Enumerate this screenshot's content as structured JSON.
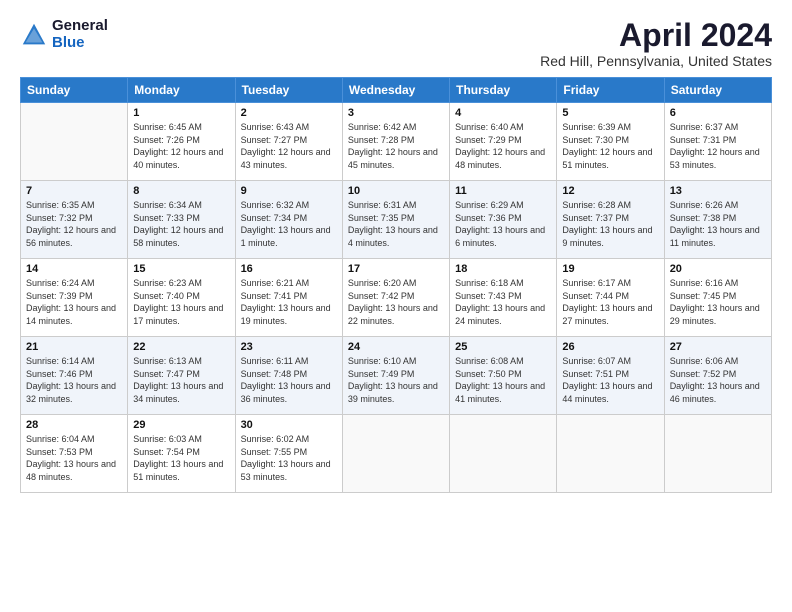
{
  "logo": {
    "general": "General",
    "blue": "Blue"
  },
  "title": "April 2024",
  "location": "Red Hill, Pennsylvania, United States",
  "days": [
    "Sunday",
    "Monday",
    "Tuesday",
    "Wednesday",
    "Thursday",
    "Friday",
    "Saturday"
  ],
  "weeks": [
    [
      {
        "date": "",
        "sunrise": "",
        "sunset": "",
        "daylight": ""
      },
      {
        "date": "1",
        "sunrise": "Sunrise: 6:45 AM",
        "sunset": "Sunset: 7:26 PM",
        "daylight": "Daylight: 12 hours and 40 minutes."
      },
      {
        "date": "2",
        "sunrise": "Sunrise: 6:43 AM",
        "sunset": "Sunset: 7:27 PM",
        "daylight": "Daylight: 12 hours and 43 minutes."
      },
      {
        "date": "3",
        "sunrise": "Sunrise: 6:42 AM",
        "sunset": "Sunset: 7:28 PM",
        "daylight": "Daylight: 12 hours and 45 minutes."
      },
      {
        "date": "4",
        "sunrise": "Sunrise: 6:40 AM",
        "sunset": "Sunset: 7:29 PM",
        "daylight": "Daylight: 12 hours and 48 minutes."
      },
      {
        "date": "5",
        "sunrise": "Sunrise: 6:39 AM",
        "sunset": "Sunset: 7:30 PM",
        "daylight": "Daylight: 12 hours and 51 minutes."
      },
      {
        "date": "6",
        "sunrise": "Sunrise: 6:37 AM",
        "sunset": "Sunset: 7:31 PM",
        "daylight": "Daylight: 12 hours and 53 minutes."
      }
    ],
    [
      {
        "date": "7",
        "sunrise": "Sunrise: 6:35 AM",
        "sunset": "Sunset: 7:32 PM",
        "daylight": "Daylight: 12 hours and 56 minutes."
      },
      {
        "date": "8",
        "sunrise": "Sunrise: 6:34 AM",
        "sunset": "Sunset: 7:33 PM",
        "daylight": "Daylight: 12 hours and 58 minutes."
      },
      {
        "date": "9",
        "sunrise": "Sunrise: 6:32 AM",
        "sunset": "Sunset: 7:34 PM",
        "daylight": "Daylight: 13 hours and 1 minute."
      },
      {
        "date": "10",
        "sunrise": "Sunrise: 6:31 AM",
        "sunset": "Sunset: 7:35 PM",
        "daylight": "Daylight: 13 hours and 4 minutes."
      },
      {
        "date": "11",
        "sunrise": "Sunrise: 6:29 AM",
        "sunset": "Sunset: 7:36 PM",
        "daylight": "Daylight: 13 hours and 6 minutes."
      },
      {
        "date": "12",
        "sunrise": "Sunrise: 6:28 AM",
        "sunset": "Sunset: 7:37 PM",
        "daylight": "Daylight: 13 hours and 9 minutes."
      },
      {
        "date": "13",
        "sunrise": "Sunrise: 6:26 AM",
        "sunset": "Sunset: 7:38 PM",
        "daylight": "Daylight: 13 hours and 11 minutes."
      }
    ],
    [
      {
        "date": "14",
        "sunrise": "Sunrise: 6:24 AM",
        "sunset": "Sunset: 7:39 PM",
        "daylight": "Daylight: 13 hours and 14 minutes."
      },
      {
        "date": "15",
        "sunrise": "Sunrise: 6:23 AM",
        "sunset": "Sunset: 7:40 PM",
        "daylight": "Daylight: 13 hours and 17 minutes."
      },
      {
        "date": "16",
        "sunrise": "Sunrise: 6:21 AM",
        "sunset": "Sunset: 7:41 PM",
        "daylight": "Daylight: 13 hours and 19 minutes."
      },
      {
        "date": "17",
        "sunrise": "Sunrise: 6:20 AM",
        "sunset": "Sunset: 7:42 PM",
        "daylight": "Daylight: 13 hours and 22 minutes."
      },
      {
        "date": "18",
        "sunrise": "Sunrise: 6:18 AM",
        "sunset": "Sunset: 7:43 PM",
        "daylight": "Daylight: 13 hours and 24 minutes."
      },
      {
        "date": "19",
        "sunrise": "Sunrise: 6:17 AM",
        "sunset": "Sunset: 7:44 PM",
        "daylight": "Daylight: 13 hours and 27 minutes."
      },
      {
        "date": "20",
        "sunrise": "Sunrise: 6:16 AM",
        "sunset": "Sunset: 7:45 PM",
        "daylight": "Daylight: 13 hours and 29 minutes."
      }
    ],
    [
      {
        "date": "21",
        "sunrise": "Sunrise: 6:14 AM",
        "sunset": "Sunset: 7:46 PM",
        "daylight": "Daylight: 13 hours and 32 minutes."
      },
      {
        "date": "22",
        "sunrise": "Sunrise: 6:13 AM",
        "sunset": "Sunset: 7:47 PM",
        "daylight": "Daylight: 13 hours and 34 minutes."
      },
      {
        "date": "23",
        "sunrise": "Sunrise: 6:11 AM",
        "sunset": "Sunset: 7:48 PM",
        "daylight": "Daylight: 13 hours and 36 minutes."
      },
      {
        "date": "24",
        "sunrise": "Sunrise: 6:10 AM",
        "sunset": "Sunset: 7:49 PM",
        "daylight": "Daylight: 13 hours and 39 minutes."
      },
      {
        "date": "25",
        "sunrise": "Sunrise: 6:08 AM",
        "sunset": "Sunset: 7:50 PM",
        "daylight": "Daylight: 13 hours and 41 minutes."
      },
      {
        "date": "26",
        "sunrise": "Sunrise: 6:07 AM",
        "sunset": "Sunset: 7:51 PM",
        "daylight": "Daylight: 13 hours and 44 minutes."
      },
      {
        "date": "27",
        "sunrise": "Sunrise: 6:06 AM",
        "sunset": "Sunset: 7:52 PM",
        "daylight": "Daylight: 13 hours and 46 minutes."
      }
    ],
    [
      {
        "date": "28",
        "sunrise": "Sunrise: 6:04 AM",
        "sunset": "Sunset: 7:53 PM",
        "daylight": "Daylight: 13 hours and 48 minutes."
      },
      {
        "date": "29",
        "sunrise": "Sunrise: 6:03 AM",
        "sunset": "Sunset: 7:54 PM",
        "daylight": "Daylight: 13 hours and 51 minutes."
      },
      {
        "date": "30",
        "sunrise": "Sunrise: 6:02 AM",
        "sunset": "Sunset: 7:55 PM",
        "daylight": "Daylight: 13 hours and 53 minutes."
      },
      {
        "date": "",
        "sunrise": "",
        "sunset": "",
        "daylight": ""
      },
      {
        "date": "",
        "sunrise": "",
        "sunset": "",
        "daylight": ""
      },
      {
        "date": "",
        "sunrise": "",
        "sunset": "",
        "daylight": ""
      },
      {
        "date": "",
        "sunrise": "",
        "sunset": "",
        "daylight": ""
      }
    ]
  ]
}
